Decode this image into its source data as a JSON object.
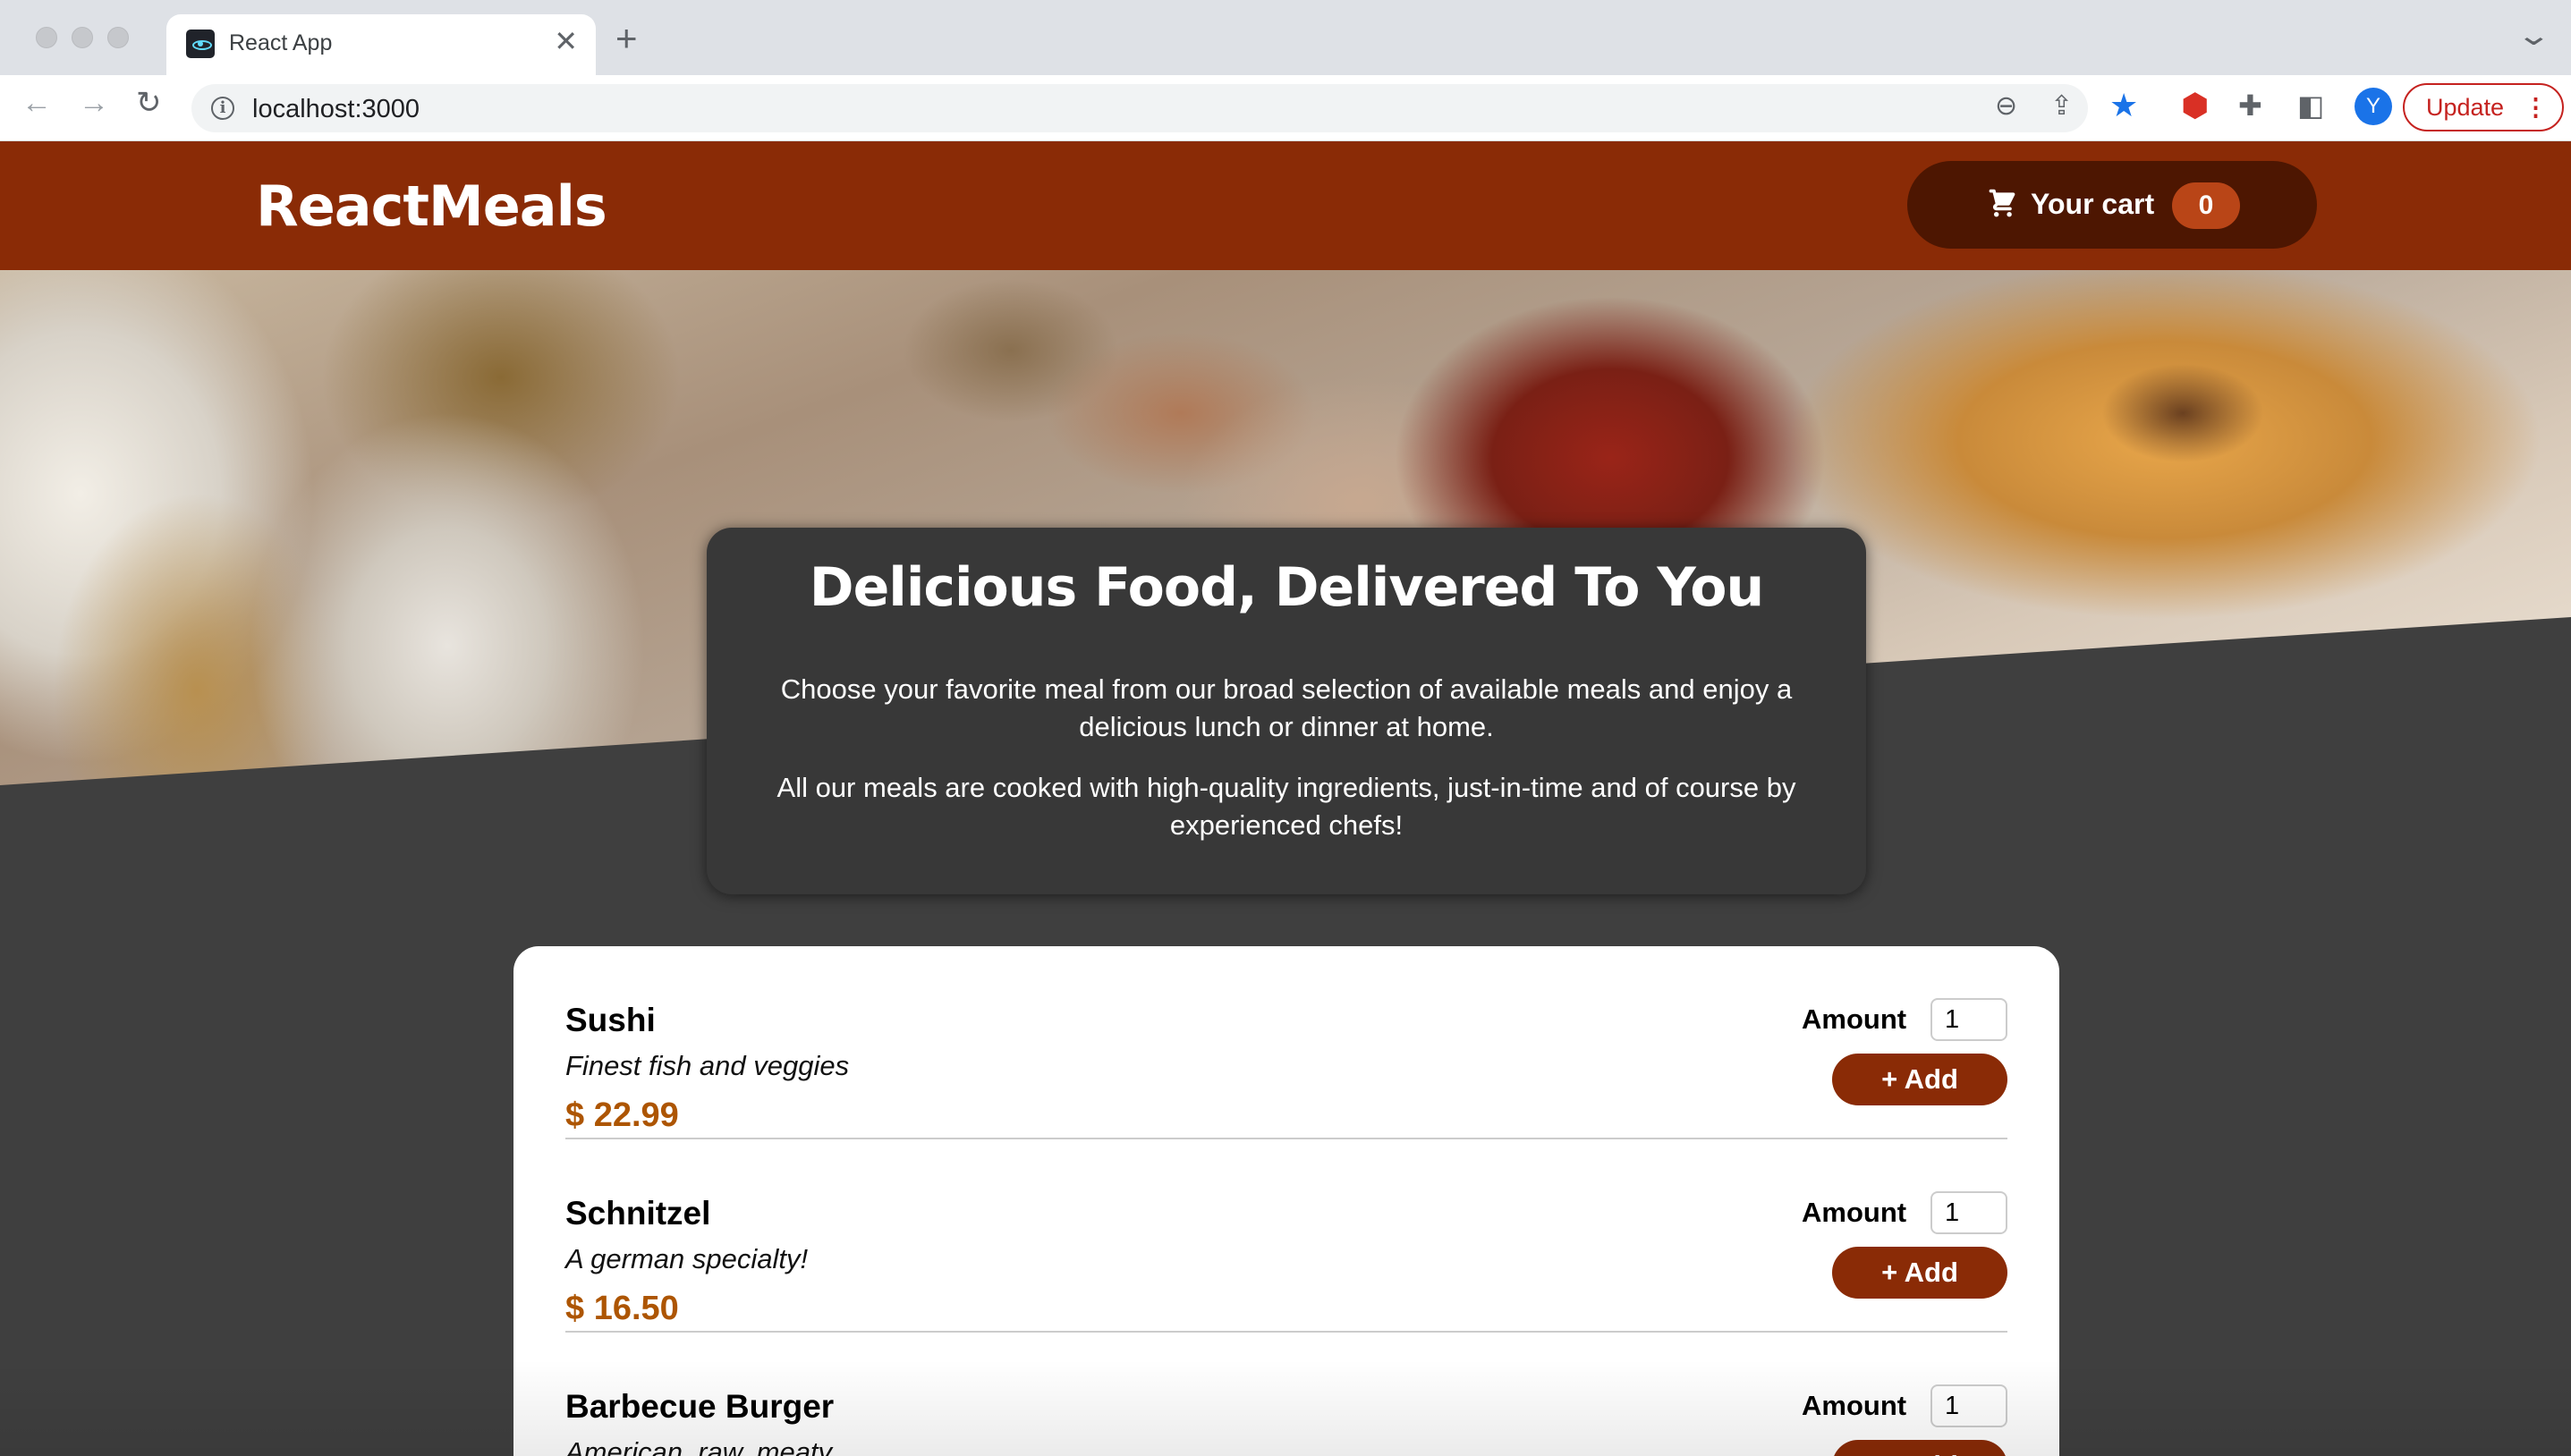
{
  "browser": {
    "tab_title": "React App",
    "url": "localhost:3000",
    "profile_initial": "Y",
    "update_label": "Update"
  },
  "header": {
    "brand": "ReactMeals",
    "cart_label": "Your cart",
    "cart_count": "0"
  },
  "summary": {
    "title": "Delicious Food, Delivered To You",
    "paragraph1": "Choose your favorite meal from our broad selection of available meals and enjoy a delicious lunch or dinner at home.",
    "paragraph2": "All our meals are cooked with high-quality ingredients, just-in-time and of course by experienced chefs!"
  },
  "meals": [
    {
      "name": "Sushi",
      "description": "Finest fish and veggies",
      "price": "$ 22.99",
      "amount_label": "Amount",
      "amount": "1",
      "add_label": "+ Add"
    },
    {
      "name": "Schnitzel",
      "description": "A german specialty!",
      "price": "$ 16.50",
      "amount_label": "Amount",
      "amount": "1",
      "add_label": "+ Add"
    },
    {
      "name": "Barbecue Burger",
      "description": "American, raw, meaty",
      "price": "",
      "amount_label": "Amount",
      "amount": "1",
      "add_label": "+ Add"
    }
  ],
  "colors": {
    "header_bg": "#8a2b06",
    "cart_button_bg": "#4d1601",
    "cart_badge_bg": "#b94517",
    "price": "#ad5502",
    "page_bg": "#3f3f3f"
  }
}
